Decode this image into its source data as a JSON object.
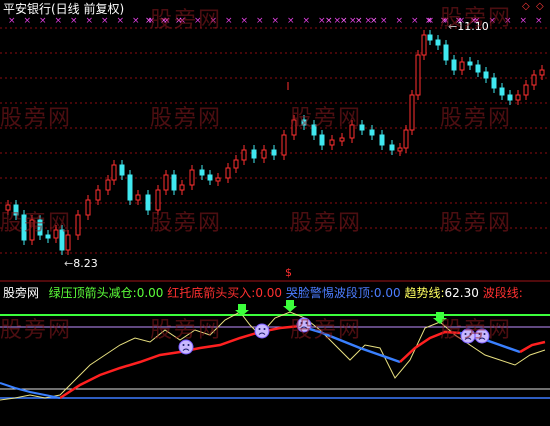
{
  "title": "平安银行(日线 前复权)",
  "corner_icons": [
    "diamond-outline-icon",
    "diamond-outline-icon"
  ],
  "high_label": "11.10",
  "low_label": "8.23",
  "marker_symbol": "$",
  "watermark": "股旁网",
  "indicator": {
    "source": "股旁网",
    "items": [
      {
        "label": "绿压顶箭头减仓:",
        "value": "0.00",
        "label_color": "#5cff3a",
        "value_color": "#5cff3a"
      },
      {
        "label": "红托底箭头买入:",
        "value": "0.00",
        "label_color": "#ff3030",
        "value_color": "#ff3030"
      },
      {
        "label": "哭脸警惕波段顶:",
        "value": "0.00",
        "label_color": "#4c7dff",
        "value_color": "#4c7dff"
      },
      {
        "label": "趋势线:",
        "value": "62.30",
        "label_color": "#ffff60",
        "value_color": "#ffffff"
      },
      {
        "label": "波段线:",
        "value": "",
        "label_color": "#ff3030",
        "value_color": "#ff3030"
      }
    ]
  },
  "colors": {
    "bull": "#ff3030",
    "bear": "#40e8f0",
    "grid": "#8a0d12",
    "green_line": "#3cff3c",
    "purple_line": "#c090ff",
    "blue_line": "#3c7aff",
    "white_line": "#e0e0e0",
    "trend": "#e8e080",
    "band_red": "#ff2020",
    "band_blue": "#3a80ff"
  }
}
